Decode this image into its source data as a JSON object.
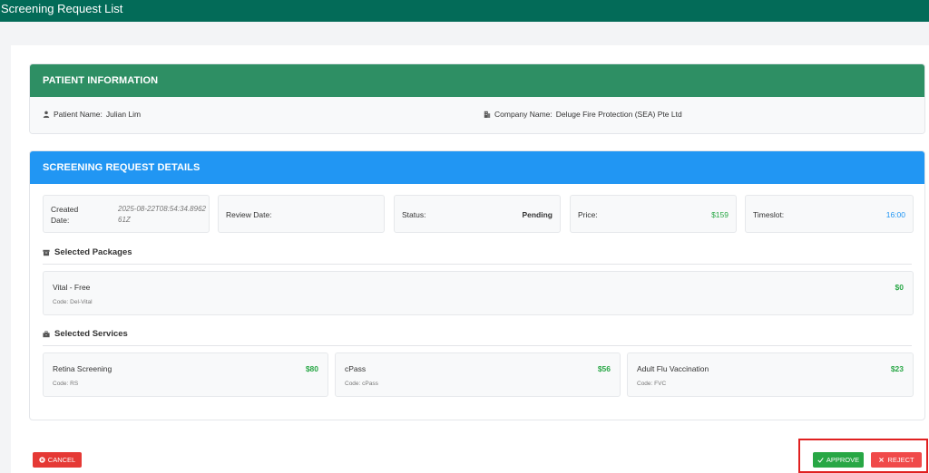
{
  "header": {
    "title": "Screening Request List"
  },
  "patient": {
    "section_title": "PATIENT INFORMATION",
    "name_label": "Patient Name:",
    "name_value": "Julian Lim",
    "company_label": "Company Name:",
    "company_value": "Deluge Fire Protection (SEA) Pte Ltd"
  },
  "details": {
    "section_title": "SCREENING REQUEST DETAILS",
    "created_label": "Created Date:",
    "created_value": "2025-08-22T08:54:34.896261Z",
    "review_label": "Review Date:",
    "review_value": "",
    "status_label": "Status:",
    "status_value": "Pending",
    "price_label": "Price:",
    "price_value": "$159",
    "timeslot_label": "Timeslot:",
    "timeslot_value": "16:00"
  },
  "packages": {
    "title": "Selected Packages",
    "items": [
      {
        "name": "Vital - Free",
        "code": "Code: Del-Vital",
        "price": "$0"
      }
    ]
  },
  "services": {
    "title": "Selected Services",
    "items": [
      {
        "name": "Retina Screening",
        "code": "Code: RS",
        "price": "$80"
      },
      {
        "name": "cPass",
        "code": "Code: cPass",
        "price": "$56"
      },
      {
        "name": "Adult Flu Vaccination",
        "code": "Code: FVC",
        "price": "$23"
      }
    ]
  },
  "actions": {
    "cancel_label": "CANCEL",
    "approve_label": "APPROVE",
    "reject_label": "REJECT"
  },
  "colors": {
    "header_bg": "#036b58",
    "patient_header": "#2e8f64",
    "details_header": "#2196f3",
    "price_green": "#28a745",
    "danger_red": "#e53935"
  },
  "icons": {
    "patient": "user-icon",
    "company": "building-icon",
    "packages": "archive-icon",
    "services": "briefcase-icon",
    "cancel": "times-circle-icon",
    "approve": "check-icon",
    "reject": "times-icon"
  }
}
